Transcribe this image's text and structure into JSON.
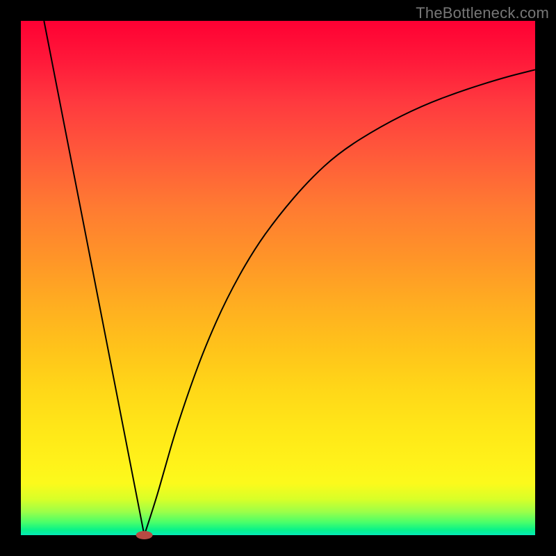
{
  "watermark": "TheBottleneck.com",
  "chart_data": {
    "type": "line",
    "title": "",
    "xlabel": "",
    "ylabel": "",
    "xlim": [
      0,
      100
    ],
    "ylim": [
      0,
      100
    ],
    "background_gradient": {
      "top": "#ff0033",
      "bottom": "#05ebb7",
      "description": "vertical red-to-green through orange/yellow"
    },
    "series": [
      {
        "name": "left-arm",
        "type": "line",
        "x": [
          4.5,
          24
        ],
        "y": [
          100,
          0
        ],
        "stroke": "#000000",
        "stroke_width": 2
      },
      {
        "name": "right-arm",
        "type": "line",
        "x": [
          24,
          26,
          28,
          30,
          33,
          36,
          40,
          45,
          50,
          56,
          62,
          70,
          78,
          86,
          94,
          100
        ],
        "y": [
          0,
          6,
          13,
          20,
          29,
          37,
          46,
          55,
          62,
          69,
          74.5,
          79.5,
          83.5,
          86.5,
          89,
          90.5
        ],
        "stroke": "#000000",
        "stroke_width": 2
      }
    ],
    "marker": {
      "name": "vertex-marker",
      "x": 24,
      "y": 0,
      "rx": 12,
      "ry": 6,
      "fill": "#b84a43"
    }
  }
}
